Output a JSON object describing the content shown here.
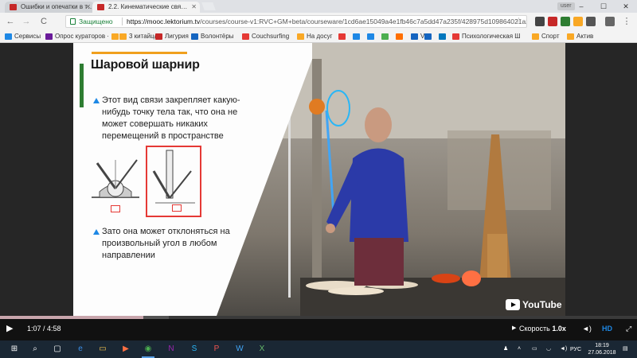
{
  "tabs": [
    {
      "title": "Ошибки и опечатки в т…",
      "active": false
    },
    {
      "title": "2.2. Кинематические свя…",
      "active": true
    }
  ],
  "window": {
    "minimize": "–",
    "maximize": "☐",
    "close": "✕",
    "user": "user"
  },
  "toolbar": {
    "back": "←",
    "forward": "→",
    "reload": "C",
    "secure_label": "Защищено",
    "url_host": "https://mooc.lektorium.tv",
    "url_path": "/courses/course-v1:RVC+GM+beta/courseware/1cd6ae15049a4e1fb46c7a5dd47a235f/428975d109864021a2acfdfb3a1…",
    "star": "☆",
    "extension_colors": [
      "#444444",
      "#c62828",
      "#2e7d32",
      "#f9a825",
      "#555555",
      "#666666"
    ]
  },
  "bookmarks": [
    {
      "label": "Сервисы",
      "color": "#1e88e5"
    },
    {
      "label": "Опрос кураторов ·",
      "color": "#6a1b9a"
    },
    {
      "label": "",
      "color": "#f9a825"
    },
    {
      "label": "3 китайца",
      "color": "#f9a825"
    },
    {
      "label": "Лигурия",
      "color": "#c62828"
    },
    {
      "label": "Волонтёры",
      "color": "#1565c0"
    },
    {
      "label": "Couchsurfing",
      "color": "#e53935"
    },
    {
      "label": "На досуг",
      "color": "#f9a825"
    },
    {
      "label": "",
      "color": "#e53935"
    },
    {
      "label": "",
      "color": "#1e88e5"
    },
    {
      "label": "",
      "color": "#1e88e5"
    },
    {
      "label": "",
      "color": "#4caf50"
    },
    {
      "label": "",
      "color": "#ff6f00"
    },
    {
      "label": "VR",
      "color": "#1565c0"
    },
    {
      "label": "",
      "color": "#1565c0"
    },
    {
      "label": "",
      "color": "#0277bd"
    },
    {
      "label": "Психологическая Ш",
      "color": "#e53935"
    },
    {
      "label": "Спорт",
      "color": "#f9a825"
    },
    {
      "label": "Актив",
      "color": "#f9a825"
    }
  ],
  "slide": {
    "title": "Шаровой шарнир",
    "bullet1": "Этот вид связи закрепляет какую-нибудь точку тела так, что она не может совершать никаких перемещений в пространстве",
    "bullet2": "Зато она может отклоняться на произвольный угол в любом направлении",
    "label_box1": "А",
    "label_box2": "А"
  },
  "video": {
    "current_time": "1:07",
    "duration": "4:58",
    "time_display": "1:07 / 4:58",
    "progress": 0.225,
    "speed_label": "Скорость",
    "speed_value": "1.0x",
    "hd_label": "HD",
    "youtube_label": "YouTube"
  },
  "taskbar": {
    "start": "⊞",
    "search": "⌕",
    "task_view": "▢",
    "lang": "РУС",
    "time": "18:19",
    "date": "27.06.2018"
  }
}
